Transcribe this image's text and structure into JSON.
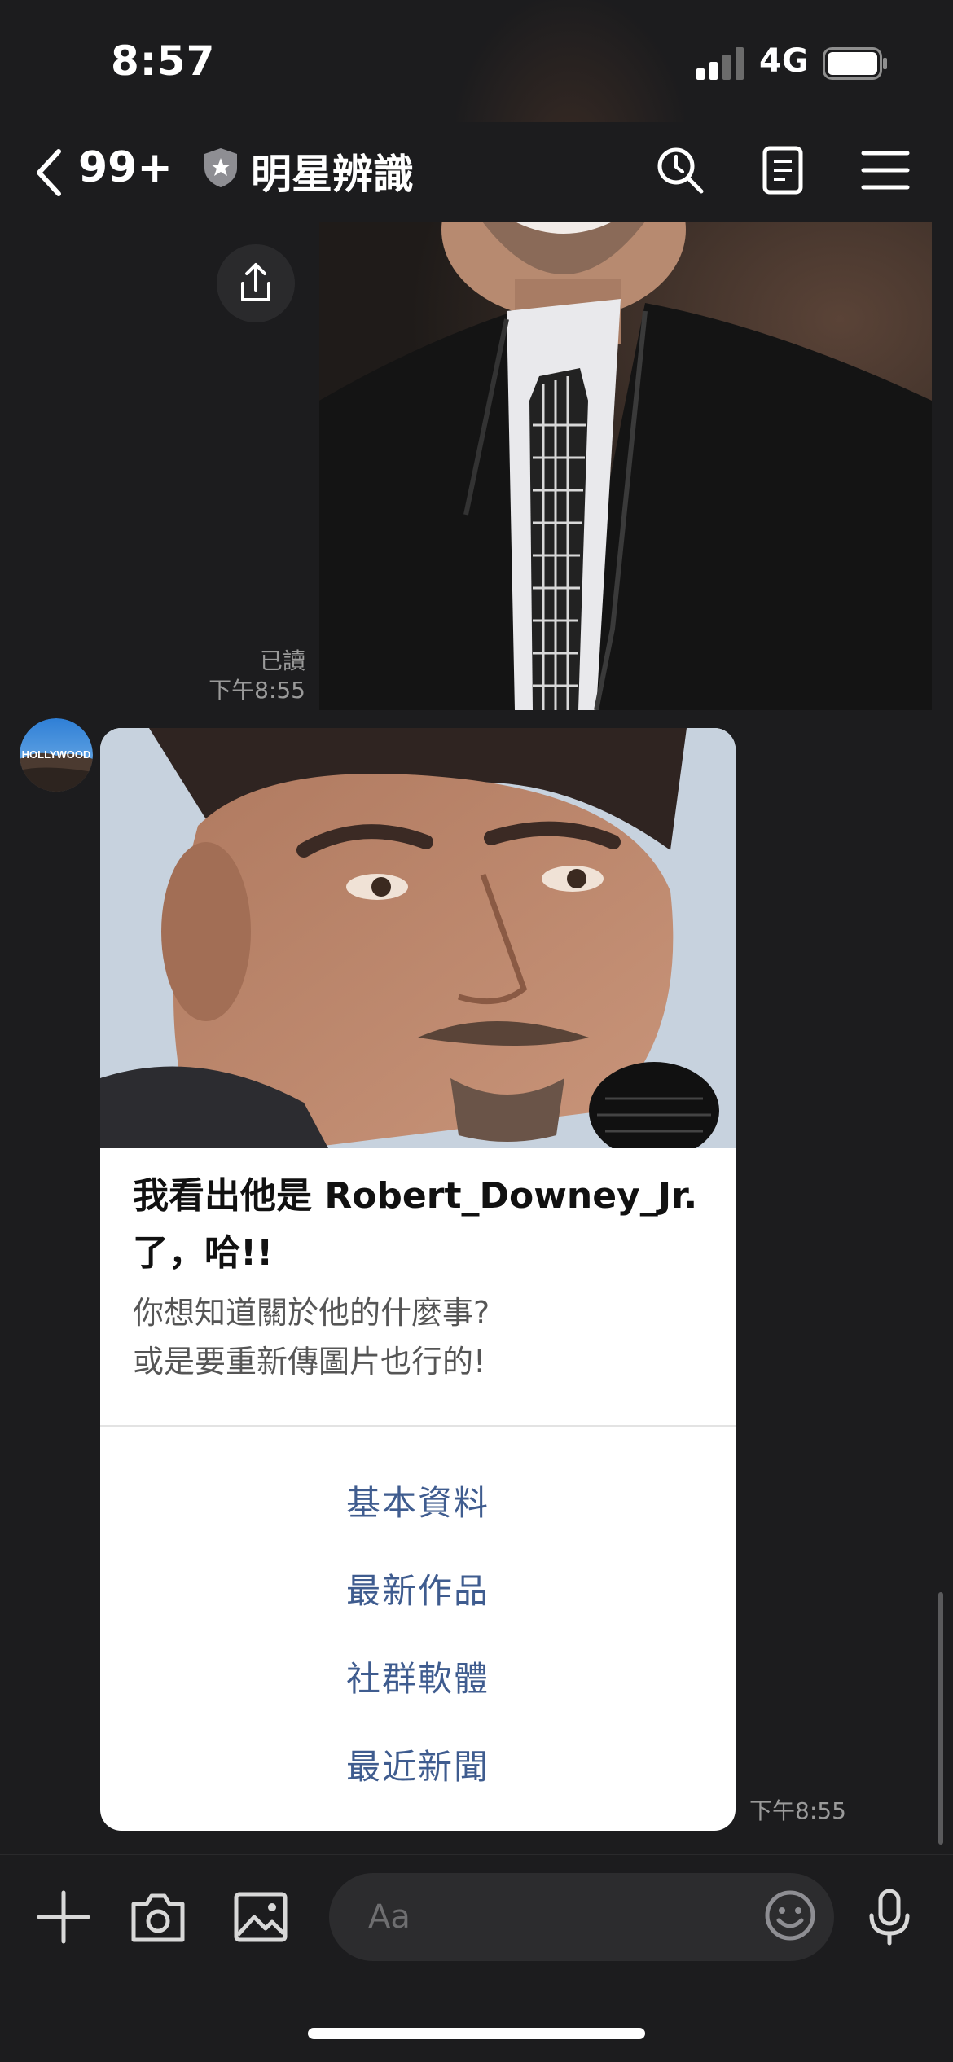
{
  "status_bar": {
    "time": "8:57",
    "network": "4G"
  },
  "header": {
    "unread_count": "99+",
    "chat_title": "明星辨識"
  },
  "sent_message": {
    "read_label": "已讀",
    "time": "下午8:55"
  },
  "card": {
    "title": "我看出他是 Robert_Downey_Jr. 了，哈!!",
    "subtitle_line1": "你想知道關於他的什麼事?",
    "subtitle_line2": "或是要重新傳圖片也行的!",
    "options": [
      "基本資料",
      "最新作品",
      "社群軟體",
      "最近新聞"
    ],
    "time": "下午8:55"
  },
  "avatar": {
    "text": "HOLLYWOOD"
  },
  "input": {
    "placeholder": "Aa"
  },
  "colors": {
    "background": "#1c1c1e",
    "option_text": "#3f5c8f",
    "card_bg": "#ffffff"
  }
}
